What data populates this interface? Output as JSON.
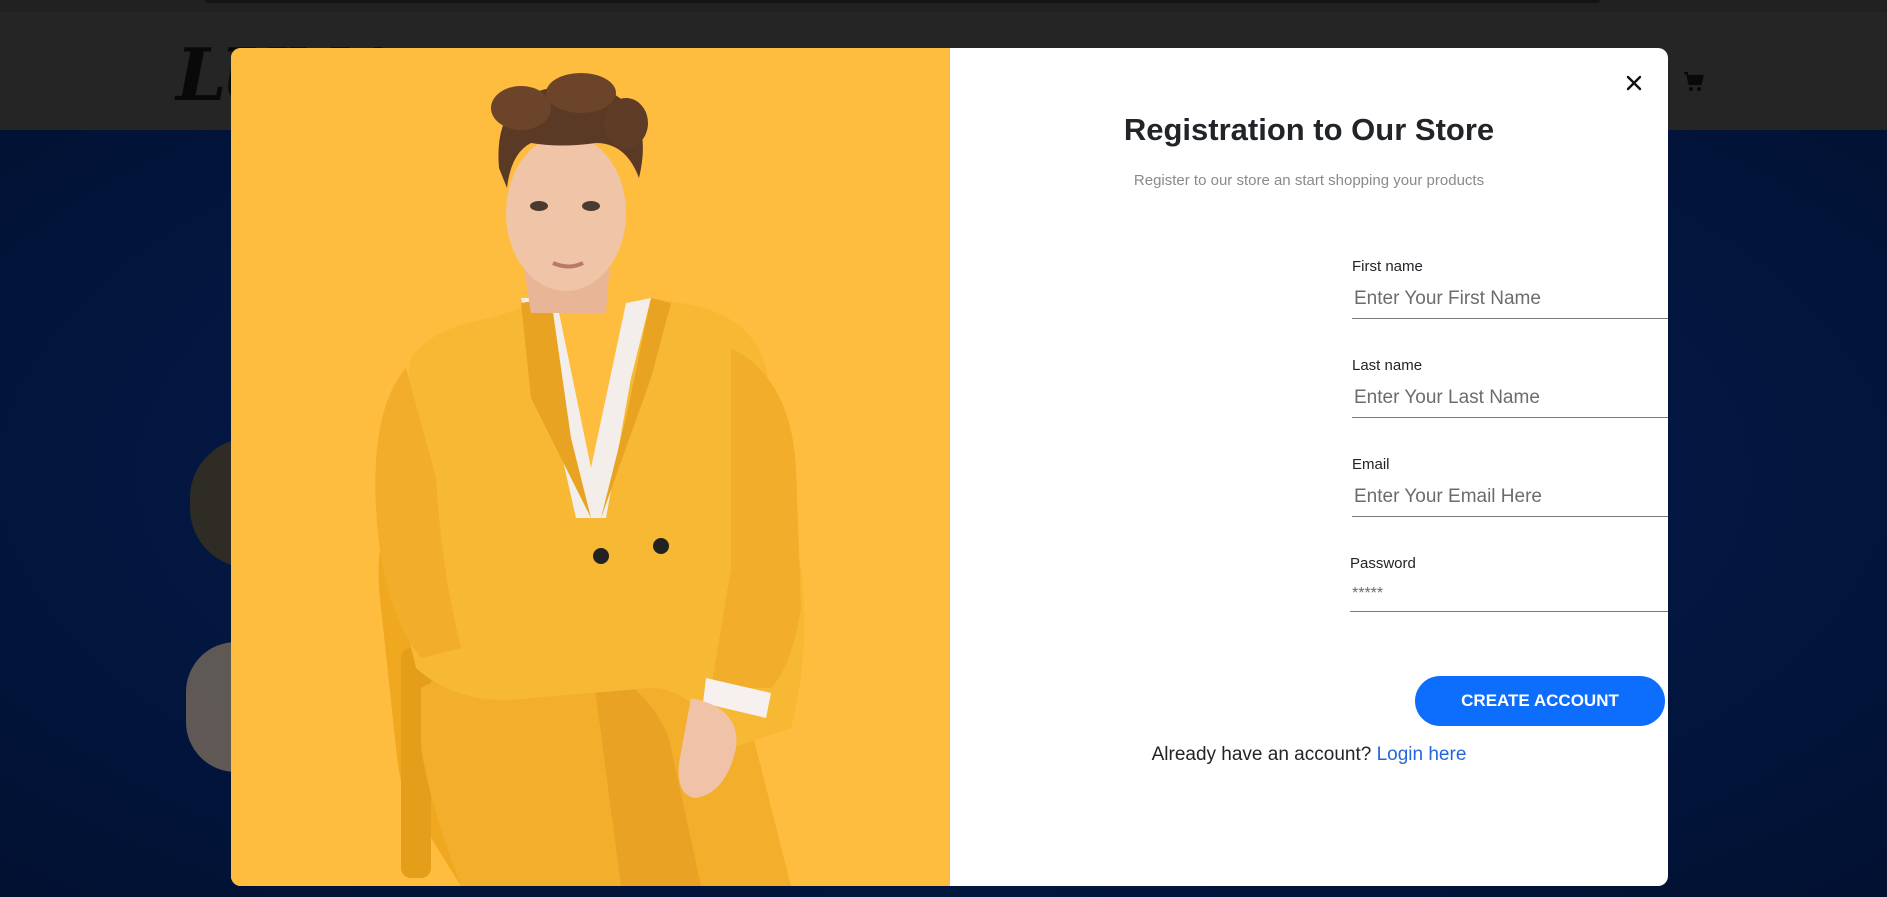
{
  "header": {
    "logo_text": "LUNA",
    "cart_icon": "cart-icon"
  },
  "modal": {
    "title": "Registration to Our Store",
    "subtitle": "Register to our store an start shopping your products",
    "close_icon": "close-icon",
    "image_description": "model-in-yellow-suit",
    "fields": [
      {
        "label": "First name",
        "placeholder": "Enter Your First Name",
        "type": "text"
      },
      {
        "label": "Last name",
        "placeholder": "Enter Your Last Name",
        "type": "text"
      },
      {
        "label": "Email",
        "placeholder": "Enter Your Email Here",
        "type": "email"
      },
      {
        "label": "Password",
        "placeholder": "*****",
        "type": "password"
      }
    ],
    "submit_label": "CREATE ACCOUNT",
    "login_prompt": "Already have an account?",
    "login_link": "Login here"
  },
  "colors": {
    "accent": "#0d6efd",
    "photo_background": "#ffbd40",
    "link": "#2667d8",
    "page_background": "#062b78"
  }
}
